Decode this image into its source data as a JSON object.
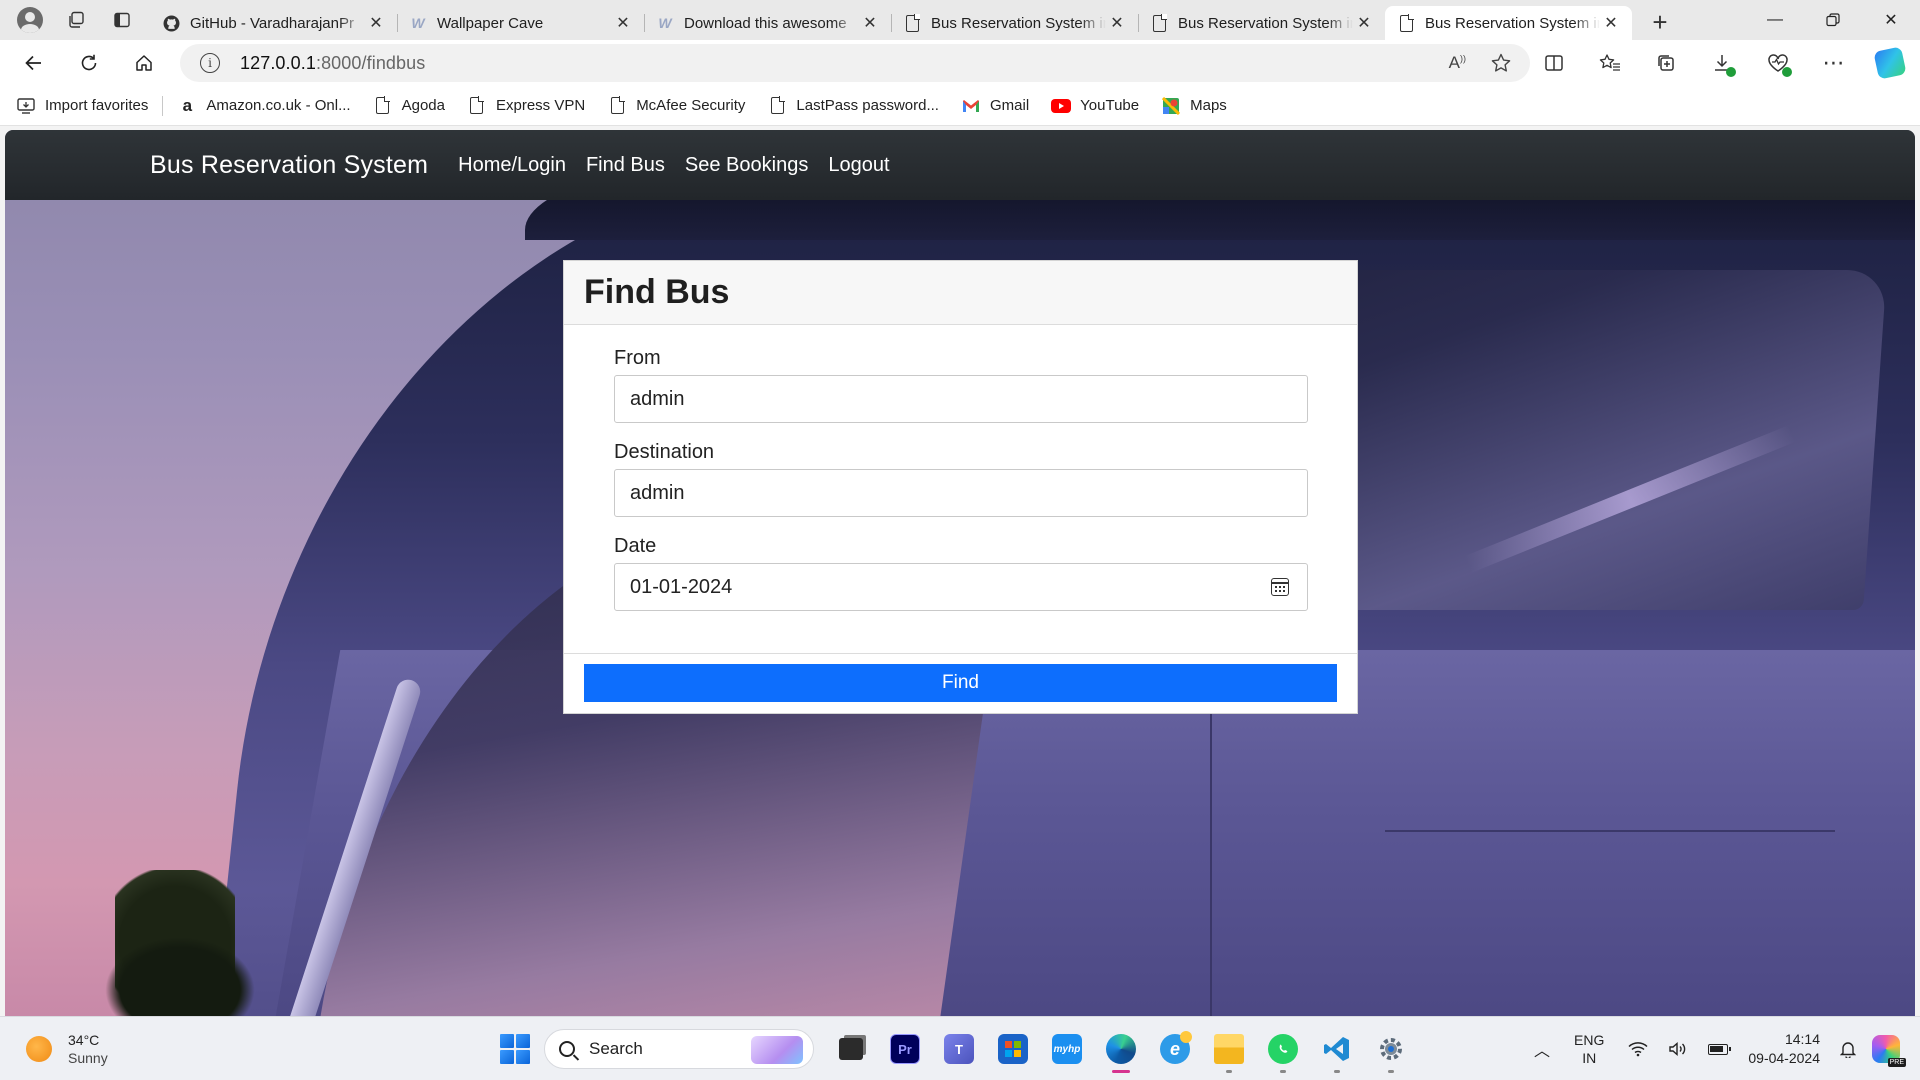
{
  "browser": {
    "tabs": [
      {
        "title": "GitHub - VaradharajanPr",
        "icon": "github-icon",
        "active": false
      },
      {
        "title": "Wallpaper Cave",
        "icon": "wallpapercave-icon",
        "active": false
      },
      {
        "title": "Download this awesome",
        "icon": "wallpapercave-icon",
        "active": false
      },
      {
        "title": "Bus Reservation System in",
        "icon": "page-icon",
        "active": false
      },
      {
        "title": "Bus Reservation System in",
        "icon": "page-icon",
        "active": false
      },
      {
        "title": "Bus Reservation System in",
        "icon": "page-icon",
        "active": true
      }
    ],
    "url_host": "127.0.0.1",
    "url_rest": ":8000/findbus",
    "favorites": [
      {
        "label": "Import favorites",
        "icon": "import-icon"
      },
      {
        "label": "Amazon.co.uk - Onl...",
        "icon": "amazon-icon"
      },
      {
        "label": "Agoda",
        "icon": "page-icon"
      },
      {
        "label": "Express VPN",
        "icon": "page-icon"
      },
      {
        "label": "McAfee Security",
        "icon": "page-icon"
      },
      {
        "label": "LastPass password...",
        "icon": "page-icon"
      },
      {
        "label": "Gmail",
        "icon": "gmail-icon"
      },
      {
        "label": "YouTube",
        "icon": "youtube-icon"
      },
      {
        "label": "Maps",
        "icon": "maps-icon"
      }
    ]
  },
  "app": {
    "brand": "Bus Reservation System",
    "nav": [
      "Home/Login",
      "Find Bus",
      "See Bookings",
      "Logout"
    ],
    "card": {
      "title": "Find Bus",
      "from_label": "From",
      "from_value": "admin",
      "destination_label": "Destination",
      "destination_value": "admin",
      "date_label": "Date",
      "date_value": "01-01-2024",
      "submit_label": "Find"
    },
    "colors": {
      "primary": "#0d6efd",
      "navbar": "#2b2f33"
    }
  },
  "taskbar": {
    "weather_temp": "34°C",
    "weather_desc": "Sunny",
    "search_placeholder": "Search",
    "lang_top": "ENG",
    "lang_bottom": "IN",
    "time": "14:14",
    "date": "09-04-2024"
  }
}
